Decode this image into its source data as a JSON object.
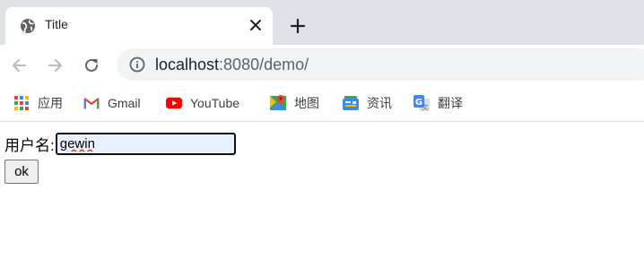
{
  "browser": {
    "tab": {
      "title": "Title",
      "favicon": "globe-icon"
    },
    "new_tab_icon": "plus-icon",
    "url": {
      "host": "localhost",
      "rest": ":8080/demo/"
    },
    "bookmarks": [
      {
        "label": "应用",
        "icon": "apps-grid-icon"
      },
      {
        "label": "Gmail",
        "icon": "gmail-icon"
      },
      {
        "label": "YouTube",
        "icon": "youtube-icon"
      },
      {
        "label": "地图",
        "icon": "maps-icon"
      },
      {
        "label": "资讯",
        "icon": "news-icon"
      },
      {
        "label": "翻译",
        "icon": "translate-icon"
      }
    ]
  },
  "page": {
    "username_label": "用户名:",
    "username_value": "gewin",
    "ok_label": "ok"
  },
  "colors": {
    "tabstrip_bg": "#dee1e6",
    "omnibox_bg": "#f1f3f4",
    "autofill_bg": "#e8f0fe"
  }
}
